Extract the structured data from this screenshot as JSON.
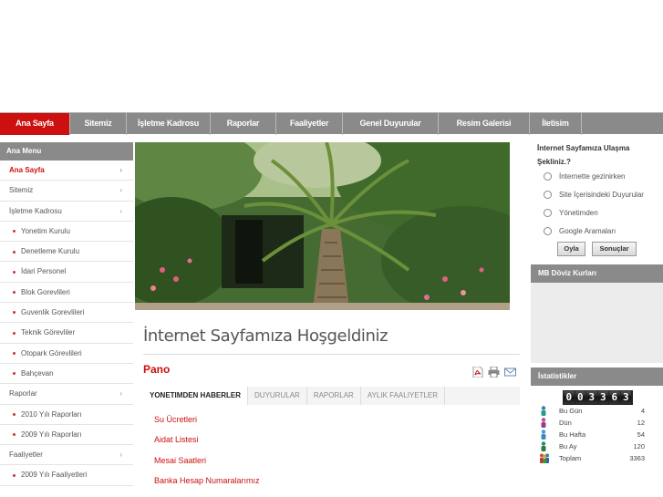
{
  "topnav": [
    "Ana Sayfa",
    "Sitemiz",
    "İşletme Kadrosu",
    "Raporlar",
    "Faaliyetler",
    "Genel Duyurular",
    "Resim Galerisi",
    "İletisim"
  ],
  "leftmenu": {
    "title": "Ana Menu",
    "items": [
      {
        "label": "Ana Sayfa",
        "arrow": "›"
      },
      {
        "label": "Sitemiz",
        "arrow": "›"
      },
      {
        "label": "İşletme Kadrosu",
        "arrow": "›"
      },
      {
        "label": "Yonetim Kurulu",
        "arrow": ""
      },
      {
        "label": "Denetleme Kurulu",
        "arrow": ""
      },
      {
        "label": "İdari Personel",
        "arrow": ""
      },
      {
        "label": "Blok Gorevlileri",
        "arrow": ""
      },
      {
        "label": "Guvenlik Gorevlileri",
        "arrow": ""
      },
      {
        "label": "Teknik Görevliler",
        "arrow": ""
      },
      {
        "label": "Otopark Görevlileri",
        "arrow": ""
      },
      {
        "label": "Bahçevan",
        "arrow": ""
      },
      {
        "label": "Raporlar",
        "arrow": "›"
      },
      {
        "label": "2010 Yılı Raporları",
        "arrow": ""
      },
      {
        "label": "2009 Yılı Raporları",
        "arrow": ""
      },
      {
        "label": "Faaliyetler",
        "arrow": "›"
      },
      {
        "label": "2009 Yılı Faaliyetleri",
        "arrow": ""
      }
    ]
  },
  "main": {
    "welcome": "İnternet Sayfamıza Hoşgeldiniz",
    "pano": "Pano",
    "tabs": [
      "YONETIMDEN HABERLER",
      "DUYURULAR",
      "RAPORLAR",
      "AYLIK FAALIYETLER"
    ],
    "news": [
      "Su Ücretleri",
      "Aidat Listesi",
      "Mesai Saatleri",
      "Banka Hesap Numaralarımız"
    ]
  },
  "poll": {
    "title": "İnternet Sayfamıza Ulaşma Şekliniz.?",
    "options": [
      "İnternette gezinirken",
      "Site İçerisindeki Duyurular",
      "Yönetimden",
      "Google Aramaları"
    ],
    "vote_label": "Oyla",
    "results_label": "Sonuçlar"
  },
  "doviz": {
    "title": "MB Döviz Kurları"
  },
  "stats": {
    "title": "İstatistikler",
    "counter": "003363",
    "rows": [
      {
        "label": "Bu Gün",
        "value": "4"
      },
      {
        "label": "Dün",
        "value": "12"
      },
      {
        "label": "Bu Hafta",
        "value": "54"
      },
      {
        "label": "Bu Ay",
        "value": "120"
      },
      {
        "label": "Toplam",
        "value": "3363"
      }
    ]
  },
  "colors": {
    "accent": "#cc1010",
    "nav": "#8a8a8a"
  }
}
